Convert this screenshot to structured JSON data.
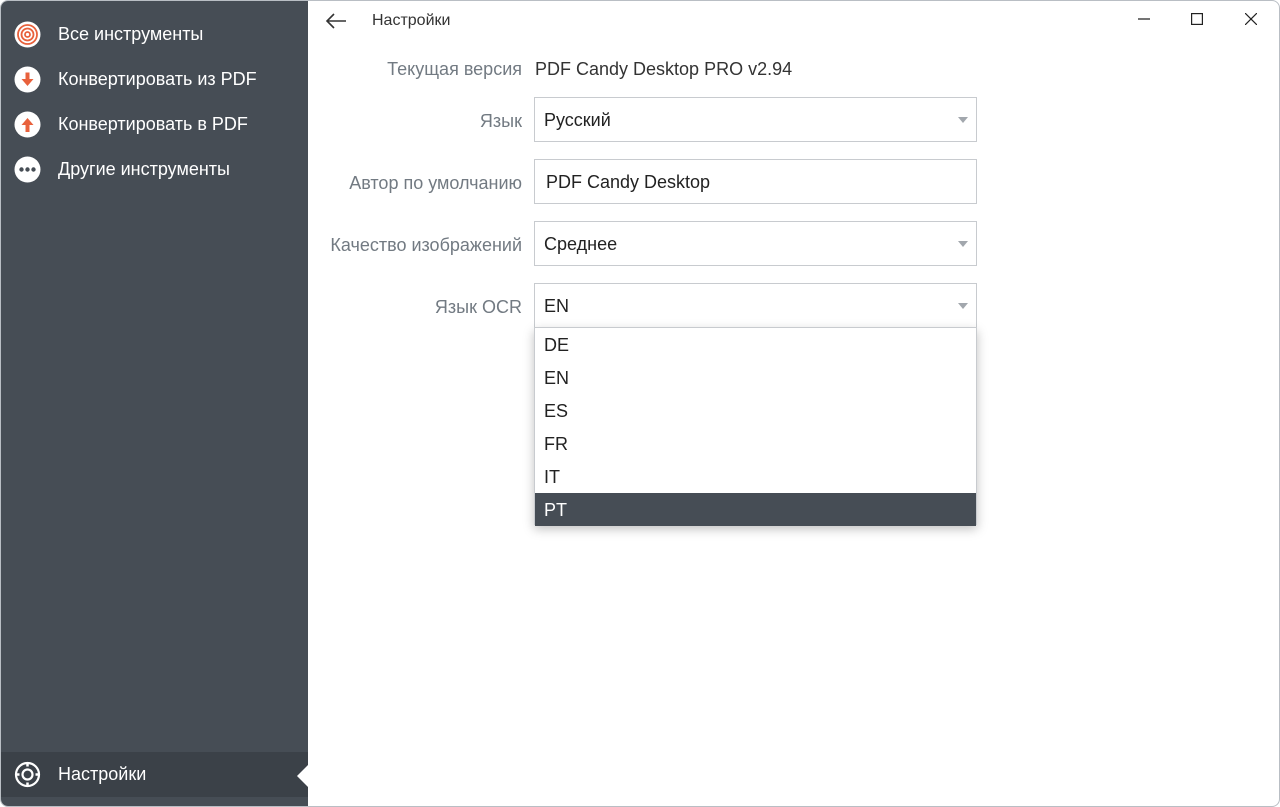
{
  "sidebar": {
    "items": [
      {
        "label": "Все инструменты",
        "icon": "spiral-icon"
      },
      {
        "label": "Конвертировать из PDF",
        "icon": "arrow-down-circle-icon"
      },
      {
        "label": "Конвертировать в PDF",
        "icon": "arrow-up-circle-icon"
      },
      {
        "label": "Другие инструменты",
        "icon": "more-dots-icon"
      }
    ],
    "settings": {
      "label": "Настройки",
      "icon": "gear-icon"
    }
  },
  "header": {
    "title": "Настройки"
  },
  "settings": {
    "version_label": "Текущая версия",
    "version_value": "PDF Candy Desktop PRO v2.94",
    "language_label": "Язык",
    "language_value": "Русский",
    "author_label": "Автор по умолчанию",
    "author_value": "PDF Candy Desktop",
    "quality_label": "Качество изображений",
    "quality_value": "Среднее",
    "ocr_label": "Язык OCR",
    "ocr_value": "EN",
    "ocr_options": [
      "DE",
      "EN",
      "ES",
      "FR",
      "IT",
      "PT"
    ],
    "ocr_highlighted": "PT"
  },
  "colors": {
    "sidebar_bg": "#464d55",
    "accent": "#e8613c",
    "highlight_bg": "#464d55"
  }
}
